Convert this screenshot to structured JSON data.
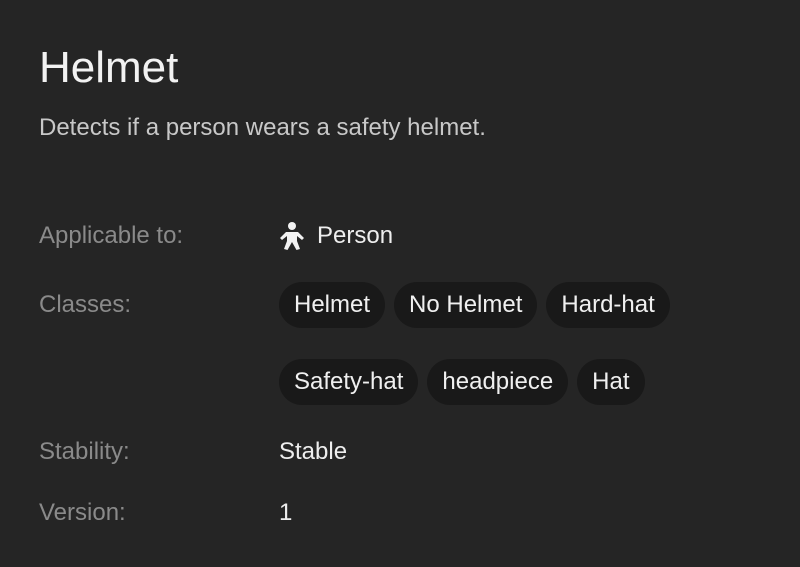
{
  "header": {
    "title": "Helmet",
    "description": "Detects if a person wears a safety helmet."
  },
  "details": {
    "applicable_label": "Applicable to:",
    "applicable_value": "Person",
    "applicable_icon": "person-icon",
    "classes_label": "Classes:",
    "classes": [
      "Helmet",
      "No Helmet",
      "Hard-hat",
      "Safety-hat",
      "headpiece",
      "Hat"
    ],
    "stability_label": "Stability:",
    "stability_value": "Stable",
    "version_label": "Version:",
    "version_value": "1"
  },
  "colors": {
    "background": "#252525",
    "chip_background": "#191919",
    "label_text": "#8a8a8a",
    "value_text": "#eeeeee"
  }
}
